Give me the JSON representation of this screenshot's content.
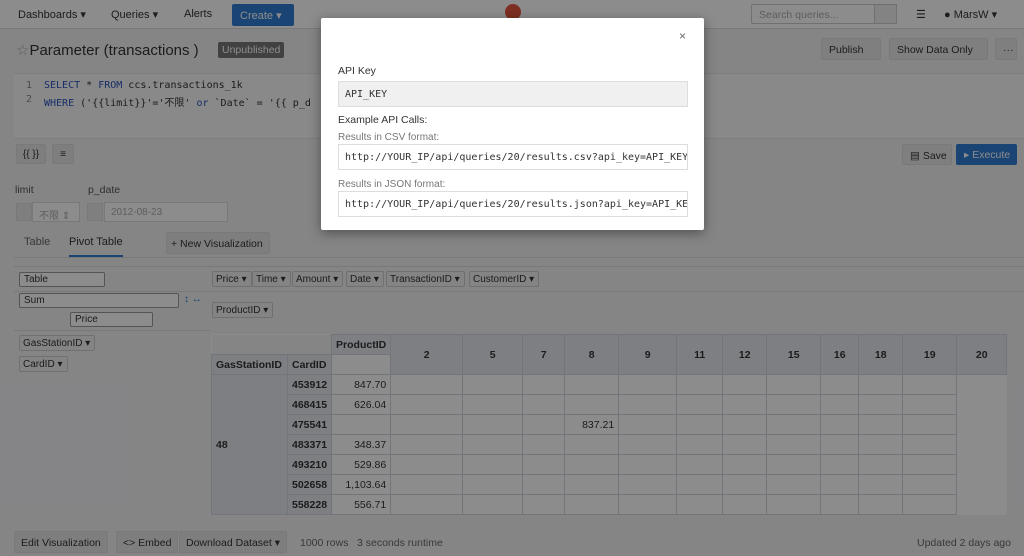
{
  "nav": {
    "dashboards": "Dashboards",
    "queries": "Queries",
    "alerts": "Alerts",
    "create": "Create",
    "search_placeholder": "Search queries...",
    "user": "MarsW"
  },
  "header": {
    "title": "Parameter (transactions )",
    "status_badge": "Unpublished",
    "publish": "Publish",
    "show_data_only": "Show Data Only",
    "more": "···"
  },
  "editor": {
    "line1_no": "1",
    "line2_no": "2",
    "line1_select": "SELECT",
    "line1_mid": " * ",
    "line1_from": "FROM",
    "line1_rest": " ccs.transactions_1k",
    "line2_where": "WHERE",
    "line2_a": " ('{{limit}}'='不限' ",
    "line2_or": "or",
    "line2_b": " `Date` = '{{ p_d"
  },
  "toolbar": {
    "params_btn": "{{ }}",
    "format_btn": "≡",
    "save": "Save",
    "execute": "Execute"
  },
  "params": {
    "limit_label": "limit",
    "limit_value": "不限",
    "pdate_label": "p_date",
    "pdate_value": "2012-08-23"
  },
  "tabs": {
    "table": "Table",
    "pivot": "Pivot Table",
    "new_vis": "+ New Visualization"
  },
  "pivot": {
    "renderer": "Table",
    "aggregator": "Sum",
    "agg_field": "Price",
    "col_chips": [
      "Price",
      "Time",
      "Amount",
      "Date",
      "TransactionID",
      "CustomerID"
    ],
    "col_attr": "ProductID",
    "row_attrs": [
      "GasStationID",
      "CardID"
    ],
    "header_productid": "ProductID",
    "header_gasstation": "GasStationID",
    "header_cardid": "CardID",
    "product_ids": [
      "2",
      "5",
      "7",
      "8",
      "9",
      "11",
      "12",
      "15",
      "16",
      "18",
      "19",
      "20"
    ],
    "gas_station": "48",
    "rows": [
      {
        "card": "453912",
        "v2": "847.70",
        "v9": ""
      },
      {
        "card": "468415",
        "v2": "626.04",
        "v9": ""
      },
      {
        "card": "475541",
        "v2": "",
        "v9": "837.21"
      },
      {
        "card": "483371",
        "v2": "348.37",
        "v9": ""
      },
      {
        "card": "493210",
        "v2": "529.86",
        "v9": ""
      },
      {
        "card": "502658",
        "v2": "1,103.64",
        "v9": ""
      },
      {
        "card": "558228",
        "v2": "556.71",
        "v9": ""
      }
    ]
  },
  "footer": {
    "edit_vis": "Edit Visualization",
    "embed": "<> Embed",
    "download": "Download Dataset",
    "rows": "1000 rows",
    "runtime": "3 seconds runtime",
    "updated": "Updated 2 days ago"
  },
  "modal": {
    "close": "×",
    "api_key_label": "API Key",
    "api_key_value": "API_KEY",
    "examples_label": "Example API Calls:",
    "csv_label": "Results in CSV format:",
    "csv_url": "http://YOUR_IP/api/queries/20/results.csv?api_key=API_KEY",
    "json_label": "Results in JSON format:",
    "json_url": "http://YOUR_IP/api/queries/20/results.json?api_key=API_KEY"
  }
}
